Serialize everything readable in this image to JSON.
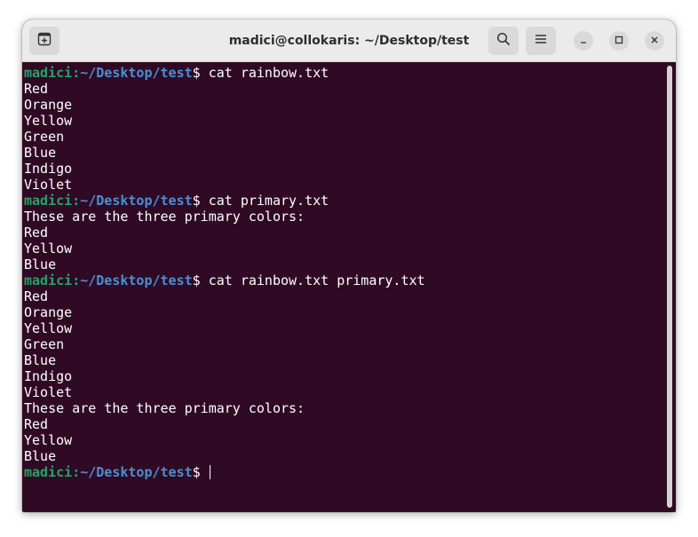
{
  "window": {
    "title": "madici@collokaris: ~/Desktop/test"
  },
  "icons": {
    "new_tab": "new-tab-icon",
    "search": "search-icon",
    "menu": "hamburger-menu-icon",
    "minimize": "minimize-icon",
    "maximize": "maximize-icon",
    "close": "close-icon"
  },
  "colors": {
    "background": "#300a24",
    "text": "#ffffff",
    "user": "#26a269",
    "path": "#4a8fd4",
    "titlebar": "#ebebeb"
  },
  "prompt": {
    "user": "madici",
    "sep": ":",
    "path": "~/Desktop/test",
    "symbol": "$"
  },
  "terminal": {
    "lines": [
      {
        "type": "prompt",
        "cmd": " cat rainbow.txt"
      },
      {
        "type": "output",
        "text": "Red"
      },
      {
        "type": "output",
        "text": "Orange"
      },
      {
        "type": "output",
        "text": "Yellow"
      },
      {
        "type": "output",
        "text": "Green"
      },
      {
        "type": "output",
        "text": "Blue"
      },
      {
        "type": "output",
        "text": "Indigo"
      },
      {
        "type": "output",
        "text": "Violet"
      },
      {
        "type": "prompt",
        "cmd": " cat primary.txt"
      },
      {
        "type": "output",
        "text": "These are the three primary colors:"
      },
      {
        "type": "output",
        "text": "Red"
      },
      {
        "type": "output",
        "text": "Yellow"
      },
      {
        "type": "output",
        "text": "Blue"
      },
      {
        "type": "prompt",
        "cmd": " cat rainbow.txt primary.txt"
      },
      {
        "type": "output",
        "text": "Red"
      },
      {
        "type": "output",
        "text": "Orange"
      },
      {
        "type": "output",
        "text": "Yellow"
      },
      {
        "type": "output",
        "text": "Green"
      },
      {
        "type": "output",
        "text": "Blue"
      },
      {
        "type": "output",
        "text": "Indigo"
      },
      {
        "type": "output",
        "text": "Violet"
      },
      {
        "type": "output",
        "text": "These are the three primary colors:"
      },
      {
        "type": "output",
        "text": "Red"
      },
      {
        "type": "output",
        "text": "Yellow"
      },
      {
        "type": "output",
        "text": "Blue"
      },
      {
        "type": "prompt",
        "cmd": " ",
        "cursor": true
      }
    ]
  }
}
